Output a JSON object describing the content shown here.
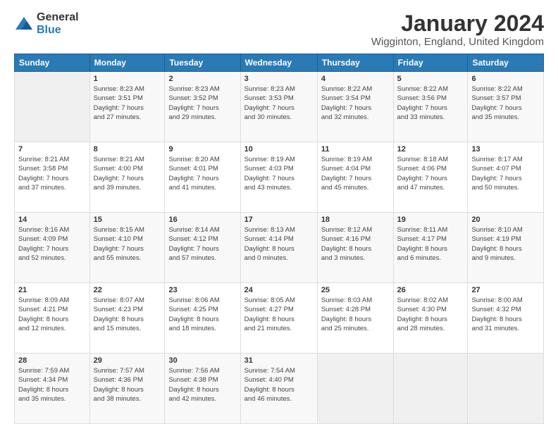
{
  "logo": {
    "general": "General",
    "blue": "Blue"
  },
  "header": {
    "title": "January 2024",
    "subtitle": "Wigginton, England, United Kingdom"
  },
  "days_of_week": [
    "Sunday",
    "Monday",
    "Tuesday",
    "Wednesday",
    "Thursday",
    "Friday",
    "Saturday"
  ],
  "weeks": [
    [
      {
        "day": "",
        "info": ""
      },
      {
        "day": "1",
        "info": "Sunrise: 8:23 AM\nSunset: 3:51 PM\nDaylight: 7 hours\nand 27 minutes."
      },
      {
        "day": "2",
        "info": "Sunrise: 8:23 AM\nSunset: 3:52 PM\nDaylight: 7 hours\nand 29 minutes."
      },
      {
        "day": "3",
        "info": "Sunrise: 8:23 AM\nSunset: 3:53 PM\nDaylight: 7 hours\nand 30 minutes."
      },
      {
        "day": "4",
        "info": "Sunrise: 8:22 AM\nSunset: 3:54 PM\nDaylight: 7 hours\nand 32 minutes."
      },
      {
        "day": "5",
        "info": "Sunrise: 8:22 AM\nSunset: 3:56 PM\nDaylight: 7 hours\nand 33 minutes."
      },
      {
        "day": "6",
        "info": "Sunrise: 8:22 AM\nSunset: 3:57 PM\nDaylight: 7 hours\nand 35 minutes."
      }
    ],
    [
      {
        "day": "7",
        "info": "Sunrise: 8:21 AM\nSunset: 3:58 PM\nDaylight: 7 hours\nand 37 minutes."
      },
      {
        "day": "8",
        "info": "Sunrise: 8:21 AM\nSunset: 4:00 PM\nDaylight: 7 hours\nand 39 minutes."
      },
      {
        "day": "9",
        "info": "Sunrise: 8:20 AM\nSunset: 4:01 PM\nDaylight: 7 hours\nand 41 minutes."
      },
      {
        "day": "10",
        "info": "Sunrise: 8:19 AM\nSunset: 4:03 PM\nDaylight: 7 hours\nand 43 minutes."
      },
      {
        "day": "11",
        "info": "Sunrise: 8:19 AM\nSunset: 4:04 PM\nDaylight: 7 hours\nand 45 minutes."
      },
      {
        "day": "12",
        "info": "Sunrise: 8:18 AM\nSunset: 4:06 PM\nDaylight: 7 hours\nand 47 minutes."
      },
      {
        "day": "13",
        "info": "Sunrise: 8:17 AM\nSunset: 4:07 PM\nDaylight: 7 hours\nand 50 minutes."
      }
    ],
    [
      {
        "day": "14",
        "info": "Sunrise: 8:16 AM\nSunset: 4:09 PM\nDaylight: 7 hours\nand 52 minutes."
      },
      {
        "day": "15",
        "info": "Sunrise: 8:15 AM\nSunset: 4:10 PM\nDaylight: 7 hours\nand 55 minutes."
      },
      {
        "day": "16",
        "info": "Sunrise: 8:14 AM\nSunset: 4:12 PM\nDaylight: 7 hours\nand 57 minutes."
      },
      {
        "day": "17",
        "info": "Sunrise: 8:13 AM\nSunset: 4:14 PM\nDaylight: 8 hours\nand 0 minutes."
      },
      {
        "day": "18",
        "info": "Sunrise: 8:12 AM\nSunset: 4:16 PM\nDaylight: 8 hours\nand 3 minutes."
      },
      {
        "day": "19",
        "info": "Sunrise: 8:11 AM\nSunset: 4:17 PM\nDaylight: 8 hours\nand 6 minutes."
      },
      {
        "day": "20",
        "info": "Sunrise: 8:10 AM\nSunset: 4:19 PM\nDaylight: 8 hours\nand 9 minutes."
      }
    ],
    [
      {
        "day": "21",
        "info": "Sunrise: 8:09 AM\nSunset: 4:21 PM\nDaylight: 8 hours\nand 12 minutes."
      },
      {
        "day": "22",
        "info": "Sunrise: 8:07 AM\nSunset: 4:23 PM\nDaylight: 8 hours\nand 15 minutes."
      },
      {
        "day": "23",
        "info": "Sunrise: 8:06 AM\nSunset: 4:25 PM\nDaylight: 8 hours\nand 18 minutes."
      },
      {
        "day": "24",
        "info": "Sunrise: 8:05 AM\nSunset: 4:27 PM\nDaylight: 8 hours\nand 21 minutes."
      },
      {
        "day": "25",
        "info": "Sunrise: 8:03 AM\nSunset: 4:28 PM\nDaylight: 8 hours\nand 25 minutes."
      },
      {
        "day": "26",
        "info": "Sunrise: 8:02 AM\nSunset: 4:30 PM\nDaylight: 8 hours\nand 28 minutes."
      },
      {
        "day": "27",
        "info": "Sunrise: 8:00 AM\nSunset: 4:32 PM\nDaylight: 8 hours\nand 31 minutes."
      }
    ],
    [
      {
        "day": "28",
        "info": "Sunrise: 7:59 AM\nSunset: 4:34 PM\nDaylight: 8 hours\nand 35 minutes."
      },
      {
        "day": "29",
        "info": "Sunrise: 7:57 AM\nSunset: 4:36 PM\nDaylight: 8 hours\nand 38 minutes."
      },
      {
        "day": "30",
        "info": "Sunrise: 7:56 AM\nSunset: 4:38 PM\nDaylight: 8 hours\nand 42 minutes."
      },
      {
        "day": "31",
        "info": "Sunrise: 7:54 AM\nSunset: 4:40 PM\nDaylight: 8 hours\nand 46 minutes."
      },
      {
        "day": "",
        "info": ""
      },
      {
        "day": "",
        "info": ""
      },
      {
        "day": "",
        "info": ""
      }
    ]
  ]
}
